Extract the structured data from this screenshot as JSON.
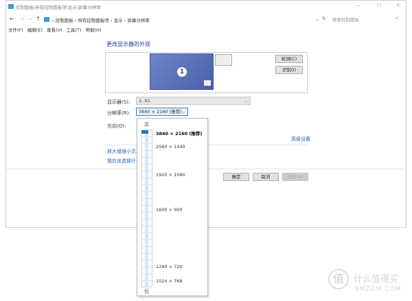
{
  "window": {
    "title": "控制面板\\所有控制面板项\\显示\\屏幕分辨率",
    "minimize": "—",
    "maximize": "☐",
    "close": "✕"
  },
  "address": {
    "crumbs": [
      "控制面板",
      "所有控制面板项",
      "显示",
      "屏幕分辨率"
    ],
    "search_placeholder": "搜索控制面板"
  },
  "menu": [
    "文件(F)",
    "编辑(E)",
    "查看(V)",
    "工具(T)",
    "帮助(H)"
  ],
  "main": {
    "heading": "更改显示器的外观",
    "monitor_number": "1",
    "detect": "检测(C)",
    "identify": "识别(I)",
    "display_label": "显示器(S):",
    "display_value": "1. X1",
    "resolution_label": "分辨率(R):",
    "resolution_value": "3840 × 2160 (推荐)",
    "orientation_label": "方向(O):",
    "advanced": "高级设置",
    "link1": "放大或缩小文本",
    "link2": "我应该选择什么",
    "ok": "确定",
    "cancel": "取消",
    "apply": "应用(A)"
  },
  "popup": {
    "high": "高",
    "low": "低",
    "options": [
      "3840 × 2160 (推荐)",
      "2560 × 1440",
      "1920 × 1080",
      "1600 × 900",
      "1280 × 720",
      "1024 × 768"
    ],
    "selected": 0
  },
  "watermark": {
    "cn": "什么值得买",
    "en": "SMZDM.COM"
  }
}
